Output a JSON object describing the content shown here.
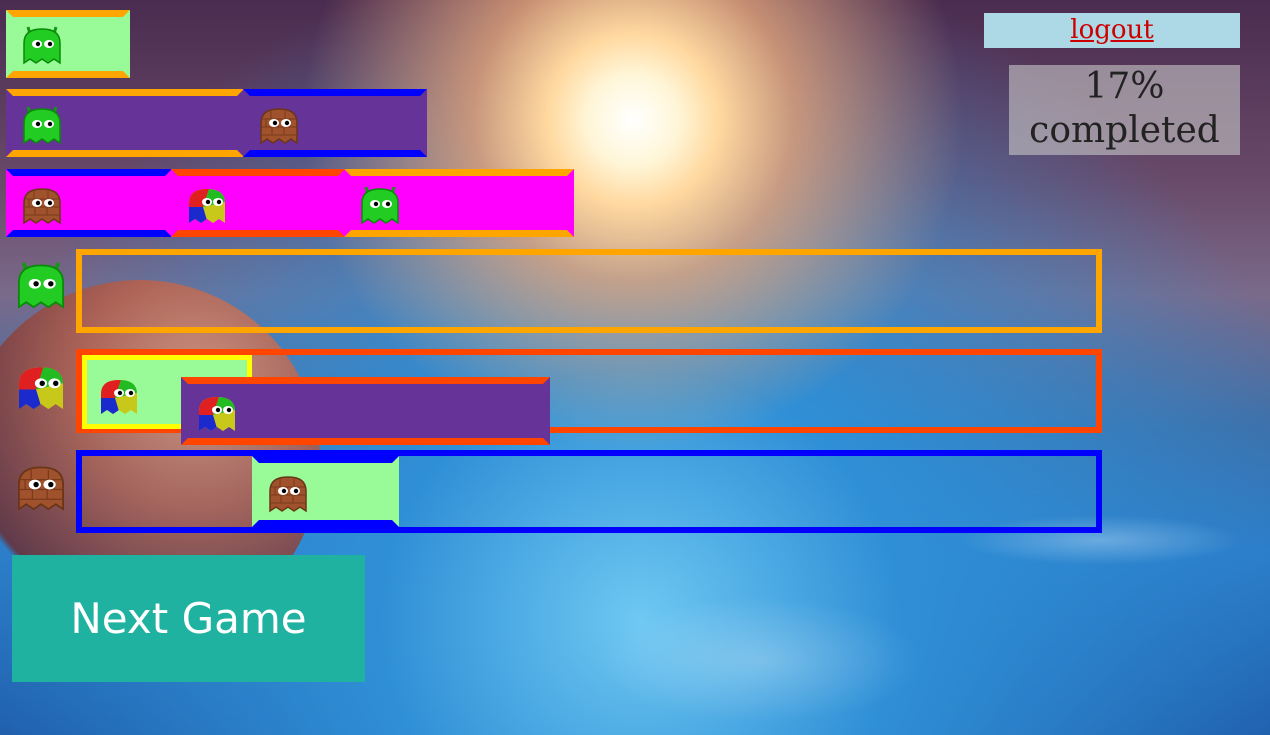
{
  "header": {
    "logout_label": "logout",
    "progress_percent": "17%",
    "progress_text": "completed"
  },
  "footer": {
    "next_game_label": "Next Game"
  },
  "colors": {
    "green_fill": "#98fb98",
    "purple_fill": "#663399",
    "magenta_fill": "#ff00ff",
    "orange": "#ffa500",
    "orangered": "#ff4500",
    "blue": "#0000ff",
    "yellow": "#ffff00",
    "teal_button": "#20b2a0",
    "logout_bg": "#add8e6"
  },
  "ghost_types": [
    "green-alien-ghost-icon",
    "brick-ghost-icon",
    "tricolor-ghost-icon"
  ]
}
